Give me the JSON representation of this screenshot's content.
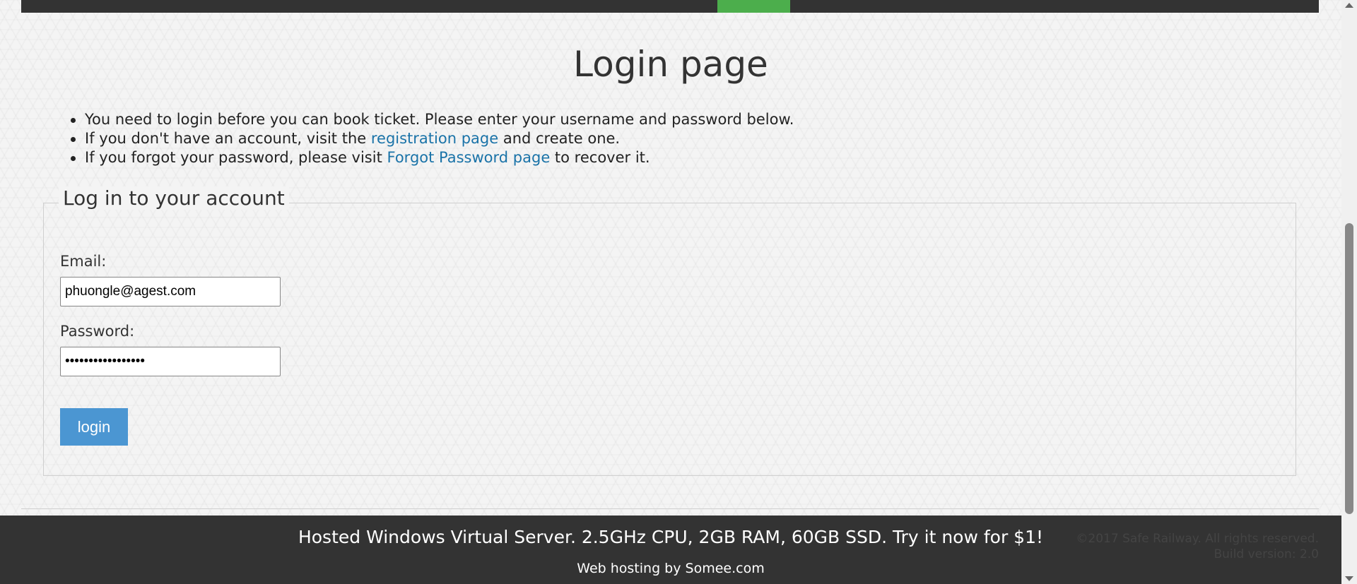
{
  "header": {
    "active_tab_color": "#4cae4c",
    "bar_color": "#333333"
  },
  "page": {
    "title": "Login page"
  },
  "info": {
    "line1": "You need to login before you can book ticket. Please enter your username and password below.",
    "line2_before": "If you don't have an account, visit the ",
    "line2_link": "registration page",
    "line2_after": " and create one.",
    "line3_before": "If you forgot your password, please visit ",
    "line3_link": "Forgot Password page",
    "line3_after": " to recover it."
  },
  "login_form": {
    "legend": "Log in to your account",
    "email_label": "Email:",
    "email_value": "phuongle@agest.com",
    "password_label": "Password:",
    "password_display": "•••••••••••••••••",
    "login_button": "login"
  },
  "footer": {
    "ad_text": "Hosted Windows Virtual Server. 2.5GHz CPU, 2GB RAM, 60GB SSD. Try it now for $1!",
    "hosting_text": "Web hosting by Somee.com",
    "copyright": "©2017 Safe Railway. All rights reserved.",
    "build_version": "Build version: 2.0"
  },
  "colors": {
    "link": "#1a73a8",
    "button": "#4b96d2",
    "footer_bg": "#333333"
  }
}
